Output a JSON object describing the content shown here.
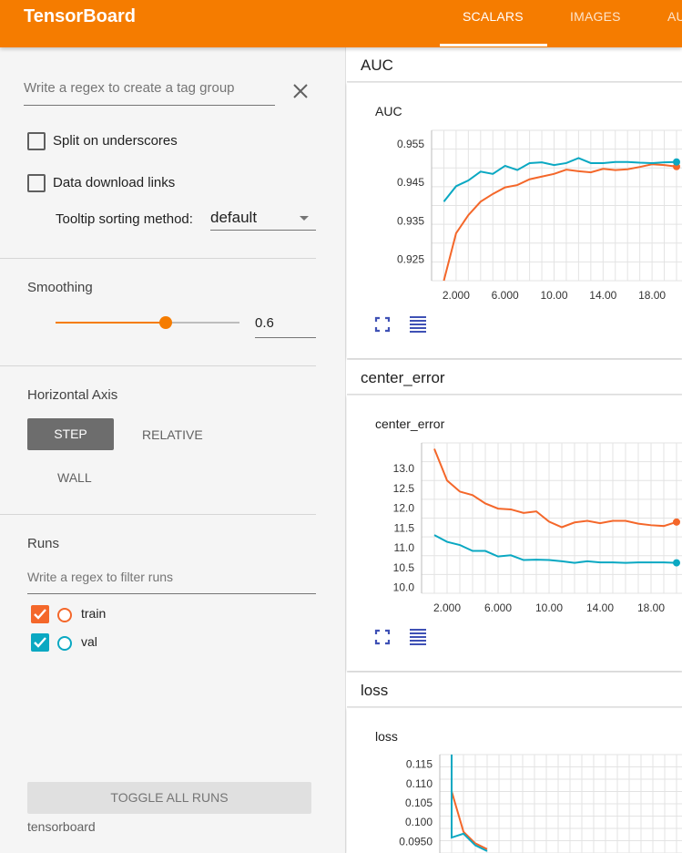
{
  "app": {
    "title": "TensorBoard"
  },
  "tabs": [
    {
      "label": "SCALARS",
      "active": true
    },
    {
      "label": "IMAGES",
      "active": false
    },
    {
      "label": "AU",
      "active": false
    }
  ],
  "sidebar": {
    "tag_regex_placeholder": "Write a regex to create a tag group",
    "split_label": "Split on underscores",
    "download_label": "Data download links",
    "tooltip_label": "Tooltip sorting method:",
    "tooltip_value": "default",
    "smoothing_title": "Smoothing",
    "smoothing_value": "0.6",
    "smoothing_fraction": 0.6,
    "axis_title": "Horizontal Axis",
    "axis_step": "STEP",
    "axis_relative": "RELATIVE",
    "axis_wall": "WALL",
    "runs_title": "Runs",
    "runs_placeholder": "Write a regex to filter runs",
    "runs": [
      {
        "name": "train",
        "color": "#f4672a",
        "checked": true
      },
      {
        "name": "val",
        "color": "#0aa8c2",
        "checked": true
      }
    ],
    "toggle_all": "TOGGLE ALL RUNS",
    "footer": "tensorboard"
  },
  "colors": {
    "accent": "#f57c00",
    "train": "#f4672a",
    "val": "#0aa8c2",
    "icon": "#3f51b5"
  },
  "groups": [
    {
      "title": "AUC"
    },
    {
      "title": "center_error"
    },
    {
      "title": "loss"
    }
  ],
  "chart_data": [
    {
      "type": "line",
      "title": "AUC",
      "xticks": [
        "2.000",
        "6.000",
        "10.00",
        "14.00",
        "18.00"
      ],
      "yticks": [
        "0.925",
        "0.935",
        "0.945",
        "0.955"
      ],
      "xlim": [
        0,
        20
      ],
      "ylim": [
        0.9195,
        0.9585
      ],
      "series": [
        {
          "name": "train",
          "color": "#f4672a",
          "x": [
            1,
            2,
            3,
            4,
            5,
            6,
            7,
            8,
            9,
            10,
            11,
            12,
            13,
            14,
            15,
            16,
            17,
            18,
            19,
            20
          ],
          "y": [
            0.9195,
            0.9318,
            0.9365,
            0.94,
            0.942,
            0.9437,
            0.9443,
            0.9458,
            0.9465,
            0.9472,
            0.9483,
            0.9479,
            0.9476,
            0.9485,
            0.9482,
            0.9484,
            0.949,
            0.9497,
            0.9495,
            0.9491
          ]
        },
        {
          "name": "val",
          "color": "#0aa8c2",
          "x": [
            1,
            2,
            3,
            4,
            5,
            6,
            7,
            8,
            9,
            10,
            11,
            12,
            13,
            14,
            15,
            16,
            17,
            18,
            19,
            20
          ],
          "y": [
            0.94,
            0.944,
            0.9455,
            0.9478,
            0.9472,
            0.9493,
            0.9482,
            0.95,
            0.9502,
            0.9495,
            0.95,
            0.9513,
            0.95,
            0.95,
            0.9503,
            0.9503,
            0.9501,
            0.95,
            0.9502,
            0.9503
          ]
        }
      ]
    },
    {
      "type": "line",
      "title": "center_error",
      "xticks": [
        "2.000",
        "6.000",
        "10.00",
        "14.00",
        "18.00"
      ],
      "yticks": [
        "10.0",
        "10.5",
        "11.0",
        "11.5",
        "12.0",
        "12.5",
        "13.0"
      ],
      "xlim": [
        0,
        20
      ],
      "ylim": [
        9.85,
        13.65
      ],
      "series": [
        {
          "name": "train",
          "color": "#f4672a",
          "x": [
            1,
            2,
            3,
            4,
            5,
            6,
            7,
            8,
            9,
            10,
            11,
            12,
            13,
            14,
            15,
            16,
            17,
            18,
            19,
            20
          ],
          "y": [
            13.5,
            12.7,
            12.42,
            12.33,
            12.12,
            11.99,
            11.97,
            11.88,
            11.92,
            11.66,
            11.52,
            11.64,
            11.68,
            11.62,
            11.68,
            11.68,
            11.61,
            11.57,
            11.55,
            11.65
          ]
        },
        {
          "name": "val",
          "color": "#0aa8c2",
          "x": [
            1,
            2,
            3,
            4,
            5,
            6,
            7,
            8,
            9,
            10,
            11,
            12,
            13,
            14,
            15,
            16,
            17,
            18,
            19,
            20
          ],
          "y": [
            11.32,
            11.15,
            11.07,
            10.92,
            10.92,
            10.78,
            10.81,
            10.69,
            10.7,
            10.69,
            10.66,
            10.62,
            10.66,
            10.63,
            10.63,
            10.62,
            10.63,
            10.63,
            10.63,
            10.62
          ]
        }
      ]
    },
    {
      "type": "line",
      "title": "loss",
      "xticks": [],
      "yticks": [
        "0.0950",
        "0.100",
        "0.105",
        "0.110",
        "0.115"
      ],
      "xlim": [
        0,
        20
      ],
      "ylim": [
        0.092,
        0.1175
      ],
      "series": [
        {
          "name": "train",
          "color": "#f4672a",
          "x": [
            1,
            2,
            3,
            4
          ],
          "y": [
            0.108,
            0.0975,
            0.0945,
            0.093
          ]
        },
        {
          "name": "val",
          "color": "#0aa8c2",
          "x": [
            1,
            1,
            2,
            3,
            4
          ],
          "y": [
            0.118,
            0.096,
            0.097,
            0.094,
            0.0925
          ]
        }
      ]
    }
  ]
}
